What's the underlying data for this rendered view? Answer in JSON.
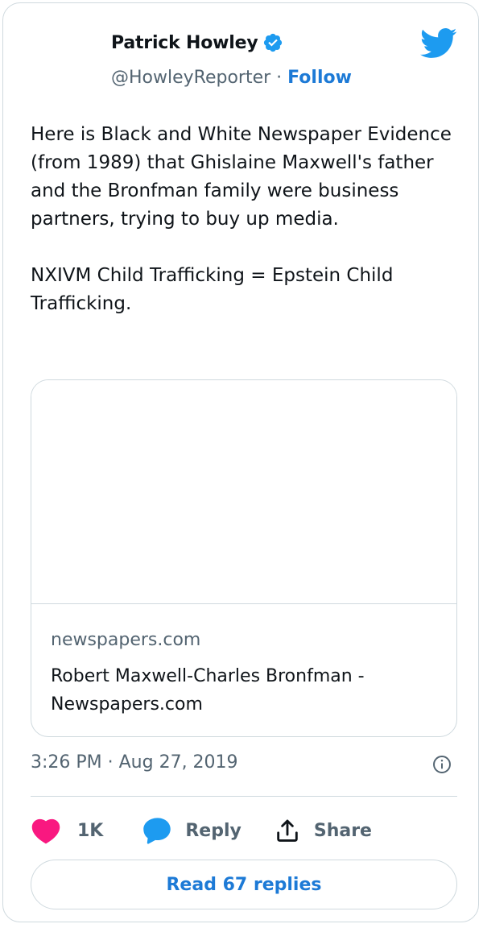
{
  "author": {
    "name": "Patrick Howley",
    "handle": "@HowleyReporter",
    "separator": " · ",
    "follow_label": "Follow"
  },
  "tweet": {
    "text": "Here is Black and White Newspaper Evidence (from 1989) that Ghislaine Maxwell's father and the Bronfman family were business partners, trying to buy up media.\n\nNXIVM Child Trafficking = Epstein Child Trafficking."
  },
  "link_card": {
    "domain": "newspapers.com",
    "title": "Robert Maxwell-Charles Bronfman - Newspapers.com"
  },
  "timestamp": "3:26 PM · Aug 27, 2019",
  "actions": {
    "like_count": "1K",
    "reply_label": "Reply",
    "share_label": "Share"
  },
  "read_replies_label": "Read 67 replies",
  "icons": {
    "verified": "verified-badge-icon",
    "logo": "twitter-bird-icon",
    "info": "info-icon",
    "like": "heart-icon",
    "reply": "speech-bubble-icon",
    "share": "share-upload-icon"
  },
  "colors": {
    "accent": "#1d9bf0",
    "link_blue": "#1d7ad6",
    "like_pink": "#f91880",
    "muted_text": "#536471",
    "border": "#cfd9de"
  }
}
